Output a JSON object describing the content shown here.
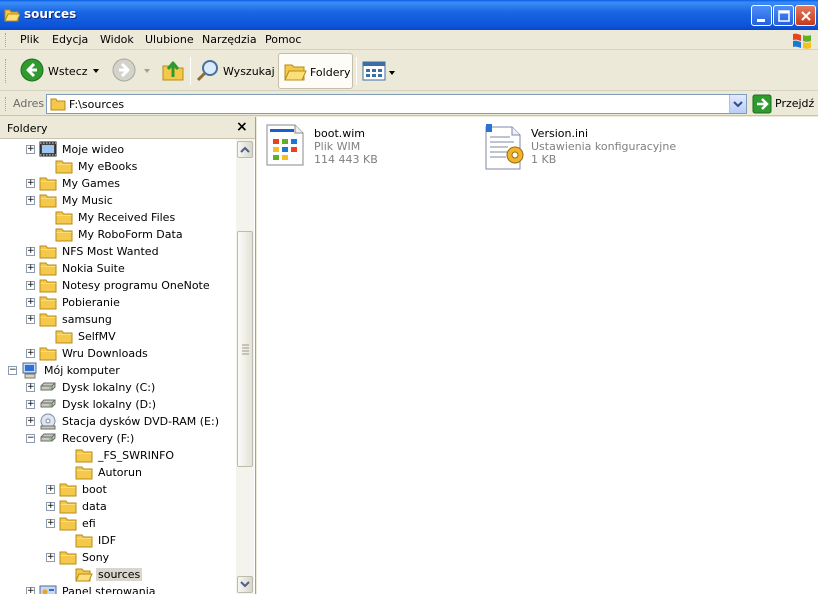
{
  "window": {
    "title": "sources"
  },
  "menu": [
    "Plik",
    "Edycja",
    "Widok",
    "Ulubione",
    "Narzędzia",
    "Pomoc"
  ],
  "toolbar": {
    "back_label": "Wstecz",
    "search_label": "Wyszukaj",
    "folders_label": "Foldery"
  },
  "address": {
    "label": "Adres",
    "value": "F:\\sources",
    "go_label": "Przejdź"
  },
  "folder_pane": {
    "title": "Foldery",
    "close_label": "×",
    "items": [
      {
        "label": "Moje wideo",
        "icon": "video-folder-icon",
        "expander": "+"
      },
      {
        "label": "My eBooks",
        "icon": "folder-icon",
        "expander": ""
      },
      {
        "label": "My Games",
        "icon": "folder-icon",
        "expander": "+"
      },
      {
        "label": "My Music",
        "icon": "folder-icon",
        "expander": "+"
      },
      {
        "label": "My Received Files",
        "icon": "folder-icon",
        "expander": ""
      },
      {
        "label": "My RoboForm Data",
        "icon": "folder-icon",
        "expander": ""
      },
      {
        "label": "NFS Most Wanted",
        "icon": "folder-icon",
        "expander": "+"
      },
      {
        "label": "Nokia Suite",
        "icon": "folder-icon",
        "expander": "+"
      },
      {
        "label": "Notesy programu OneNote",
        "icon": "folder-icon",
        "expander": "+"
      },
      {
        "label": "Pobieranie",
        "icon": "folder-icon",
        "expander": "+"
      },
      {
        "label": "samsung",
        "icon": "folder-icon",
        "expander": "+"
      },
      {
        "label": "SelfMV",
        "icon": "folder-icon",
        "expander": ""
      },
      {
        "label": "Wru Downloads",
        "icon": "folder-icon",
        "expander": "+"
      },
      {
        "label": "Mój komputer",
        "icon": "computer-icon",
        "expander": "−"
      },
      {
        "label": "Dysk lokalny (C:)",
        "icon": "drive-icon",
        "expander": "+"
      },
      {
        "label": "Dysk lokalny (D:)",
        "icon": "drive-icon",
        "expander": "+"
      },
      {
        "label": "Stacja dysków DVD-RAM (E:)",
        "icon": "dvd-drive-icon",
        "expander": "+"
      },
      {
        "label": "Recovery (F:)",
        "icon": "drive-icon",
        "expander": "−"
      },
      {
        "label": "_FS_SWRINFO",
        "icon": "folder-icon",
        "expander": ""
      },
      {
        "label": "Autorun",
        "icon": "folder-icon",
        "expander": ""
      },
      {
        "label": "boot",
        "icon": "folder-icon",
        "expander": "+"
      },
      {
        "label": "data",
        "icon": "folder-icon",
        "expander": "+"
      },
      {
        "label": "efi",
        "icon": "folder-icon",
        "expander": "+"
      },
      {
        "label": "IDF",
        "icon": "folder-icon",
        "expander": ""
      },
      {
        "label": "Sony",
        "icon": "folder-icon",
        "expander": "+"
      },
      {
        "label": "sources",
        "icon": "open-folder-icon",
        "expander": "",
        "selected": true
      },
      {
        "label": "Panel sterowania",
        "icon": "control-panel-icon",
        "expander": "+"
      }
    ]
  },
  "files": [
    {
      "name": "boot.wim",
      "type": "Plik WIM",
      "size": "114 443 KB",
      "icon": "wim-file-icon"
    },
    {
      "name": "Version.ini",
      "type": "Ustawienia konfiguracyjne",
      "size": "1 KB",
      "icon": "ini-file-icon"
    }
  ],
  "colors": {
    "titlebar": "#0b53d8",
    "selection": "#d8d6cd",
    "folder": "#f4c84a",
    "go_green": "#2f9b2f"
  }
}
